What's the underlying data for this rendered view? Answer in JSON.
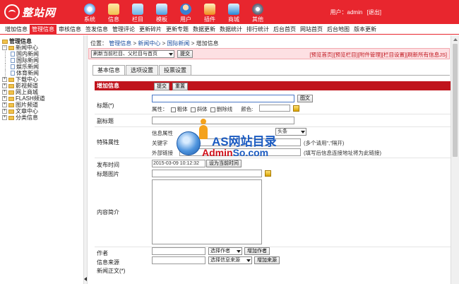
{
  "header": {
    "logo_text": "整站网",
    "nav": [
      {
        "label": "系统",
        "icon": "system-icon"
      },
      {
        "label": "信息",
        "icon": "info-icon"
      },
      {
        "label": "栏目",
        "icon": "column-icon"
      },
      {
        "label": "模板",
        "icon": "template-icon"
      },
      {
        "label": "用户",
        "icon": "user-icon"
      },
      {
        "label": "插件",
        "icon": "plugin-icon"
      },
      {
        "label": "商城",
        "icon": "shop-icon"
      },
      {
        "label": "其他",
        "icon": "other-icon"
      }
    ],
    "user_prefix": "用户：",
    "username": "admin",
    "logout": "[退出]"
  },
  "submenu": [
    "增加信息",
    "管理信息",
    "审核信息",
    "签发信息",
    "管理评论",
    "更新碎片",
    "更新专题",
    "数据更新",
    "数据统计",
    "排行统计",
    "后台首页",
    "网站首页",
    "后台地图",
    "版本更新"
  ],
  "submenu_active": 1,
  "tree": {
    "title": "管理信息",
    "items": [
      {
        "label": "新闻中心",
        "level": 0,
        "type": "folder",
        "expanded": true
      },
      {
        "label": "国内新闻",
        "level": 1,
        "type": "page"
      },
      {
        "label": "国际新闻",
        "level": 1,
        "type": "page"
      },
      {
        "label": "娱乐新闻",
        "level": 1,
        "type": "page"
      },
      {
        "label": "体育新闻",
        "level": 1,
        "type": "page"
      },
      {
        "label": "下载中心",
        "level": 0,
        "type": "folder",
        "expanded": false
      },
      {
        "label": "影视频道",
        "level": 0,
        "type": "folder",
        "expanded": false
      },
      {
        "label": "网上商城",
        "level": 0,
        "type": "folder",
        "expanded": false
      },
      {
        "label": "FLASH频道",
        "level": 0,
        "type": "folder",
        "expanded": false
      },
      {
        "label": "图片频道",
        "level": 0,
        "type": "folder",
        "expanded": false
      },
      {
        "label": "文章中心",
        "level": 0,
        "type": "folder",
        "expanded": false
      },
      {
        "label": "分类信息",
        "level": 0,
        "type": "folder",
        "expanded": false
      }
    ]
  },
  "breadcrumb": {
    "prefix": "位置：",
    "links": [
      "管理信息",
      "新闻中心",
      "国际新闻"
    ],
    "current": "增加信息",
    "separator": ">"
  },
  "toolbar": {
    "refresh_select": "刷新当前栏目、父栏目与首页",
    "submit": "提交",
    "links": [
      "[预览首页]",
      "[预览栏目]",
      "[附件管理]",
      "[栏目设置]",
      "[刷新所有信息JS]"
    ]
  },
  "tabs": [
    "基本信息",
    "选项设置",
    "投票设置"
  ],
  "tab_active": 0,
  "form": {
    "title": "增加信息",
    "submit": "提交",
    "reset": "重置",
    "title_label": "标题(*)",
    "image_btn": "图文",
    "attr_label": "属性：",
    "bold": "粗体",
    "italic": "斜体",
    "strike": "删除线",
    "color_label": "颜色:",
    "subtitle_label": "副标题",
    "special_label": "特殊属性",
    "info_attr_label": "信息属性",
    "info_attr_select": "头条",
    "keyword_label": "关键字",
    "keyword_hint": "(多个请用\",\"隔开)",
    "ext_link_label": "外部链接",
    "ext_link_hint": "(填写后信息连接地址将为此链接)",
    "date_label": "发布时间",
    "date_value": "2015-03-09 10:12:32",
    "date_btn": "设为当前时间",
    "titlepic_label": "标题图片",
    "intro_label": "内容简介",
    "author_label": "作者",
    "author_select": "选择作者",
    "author_add": "增加作者",
    "source_label": "信息来源",
    "source_select": "选择信息来源",
    "source_add": "增加来源",
    "content_label": "新闻正文(*)"
  },
  "watermark": {
    "line1": "AS网站目录",
    "line2a": "Admin",
    "line2b": "So.com"
  }
}
